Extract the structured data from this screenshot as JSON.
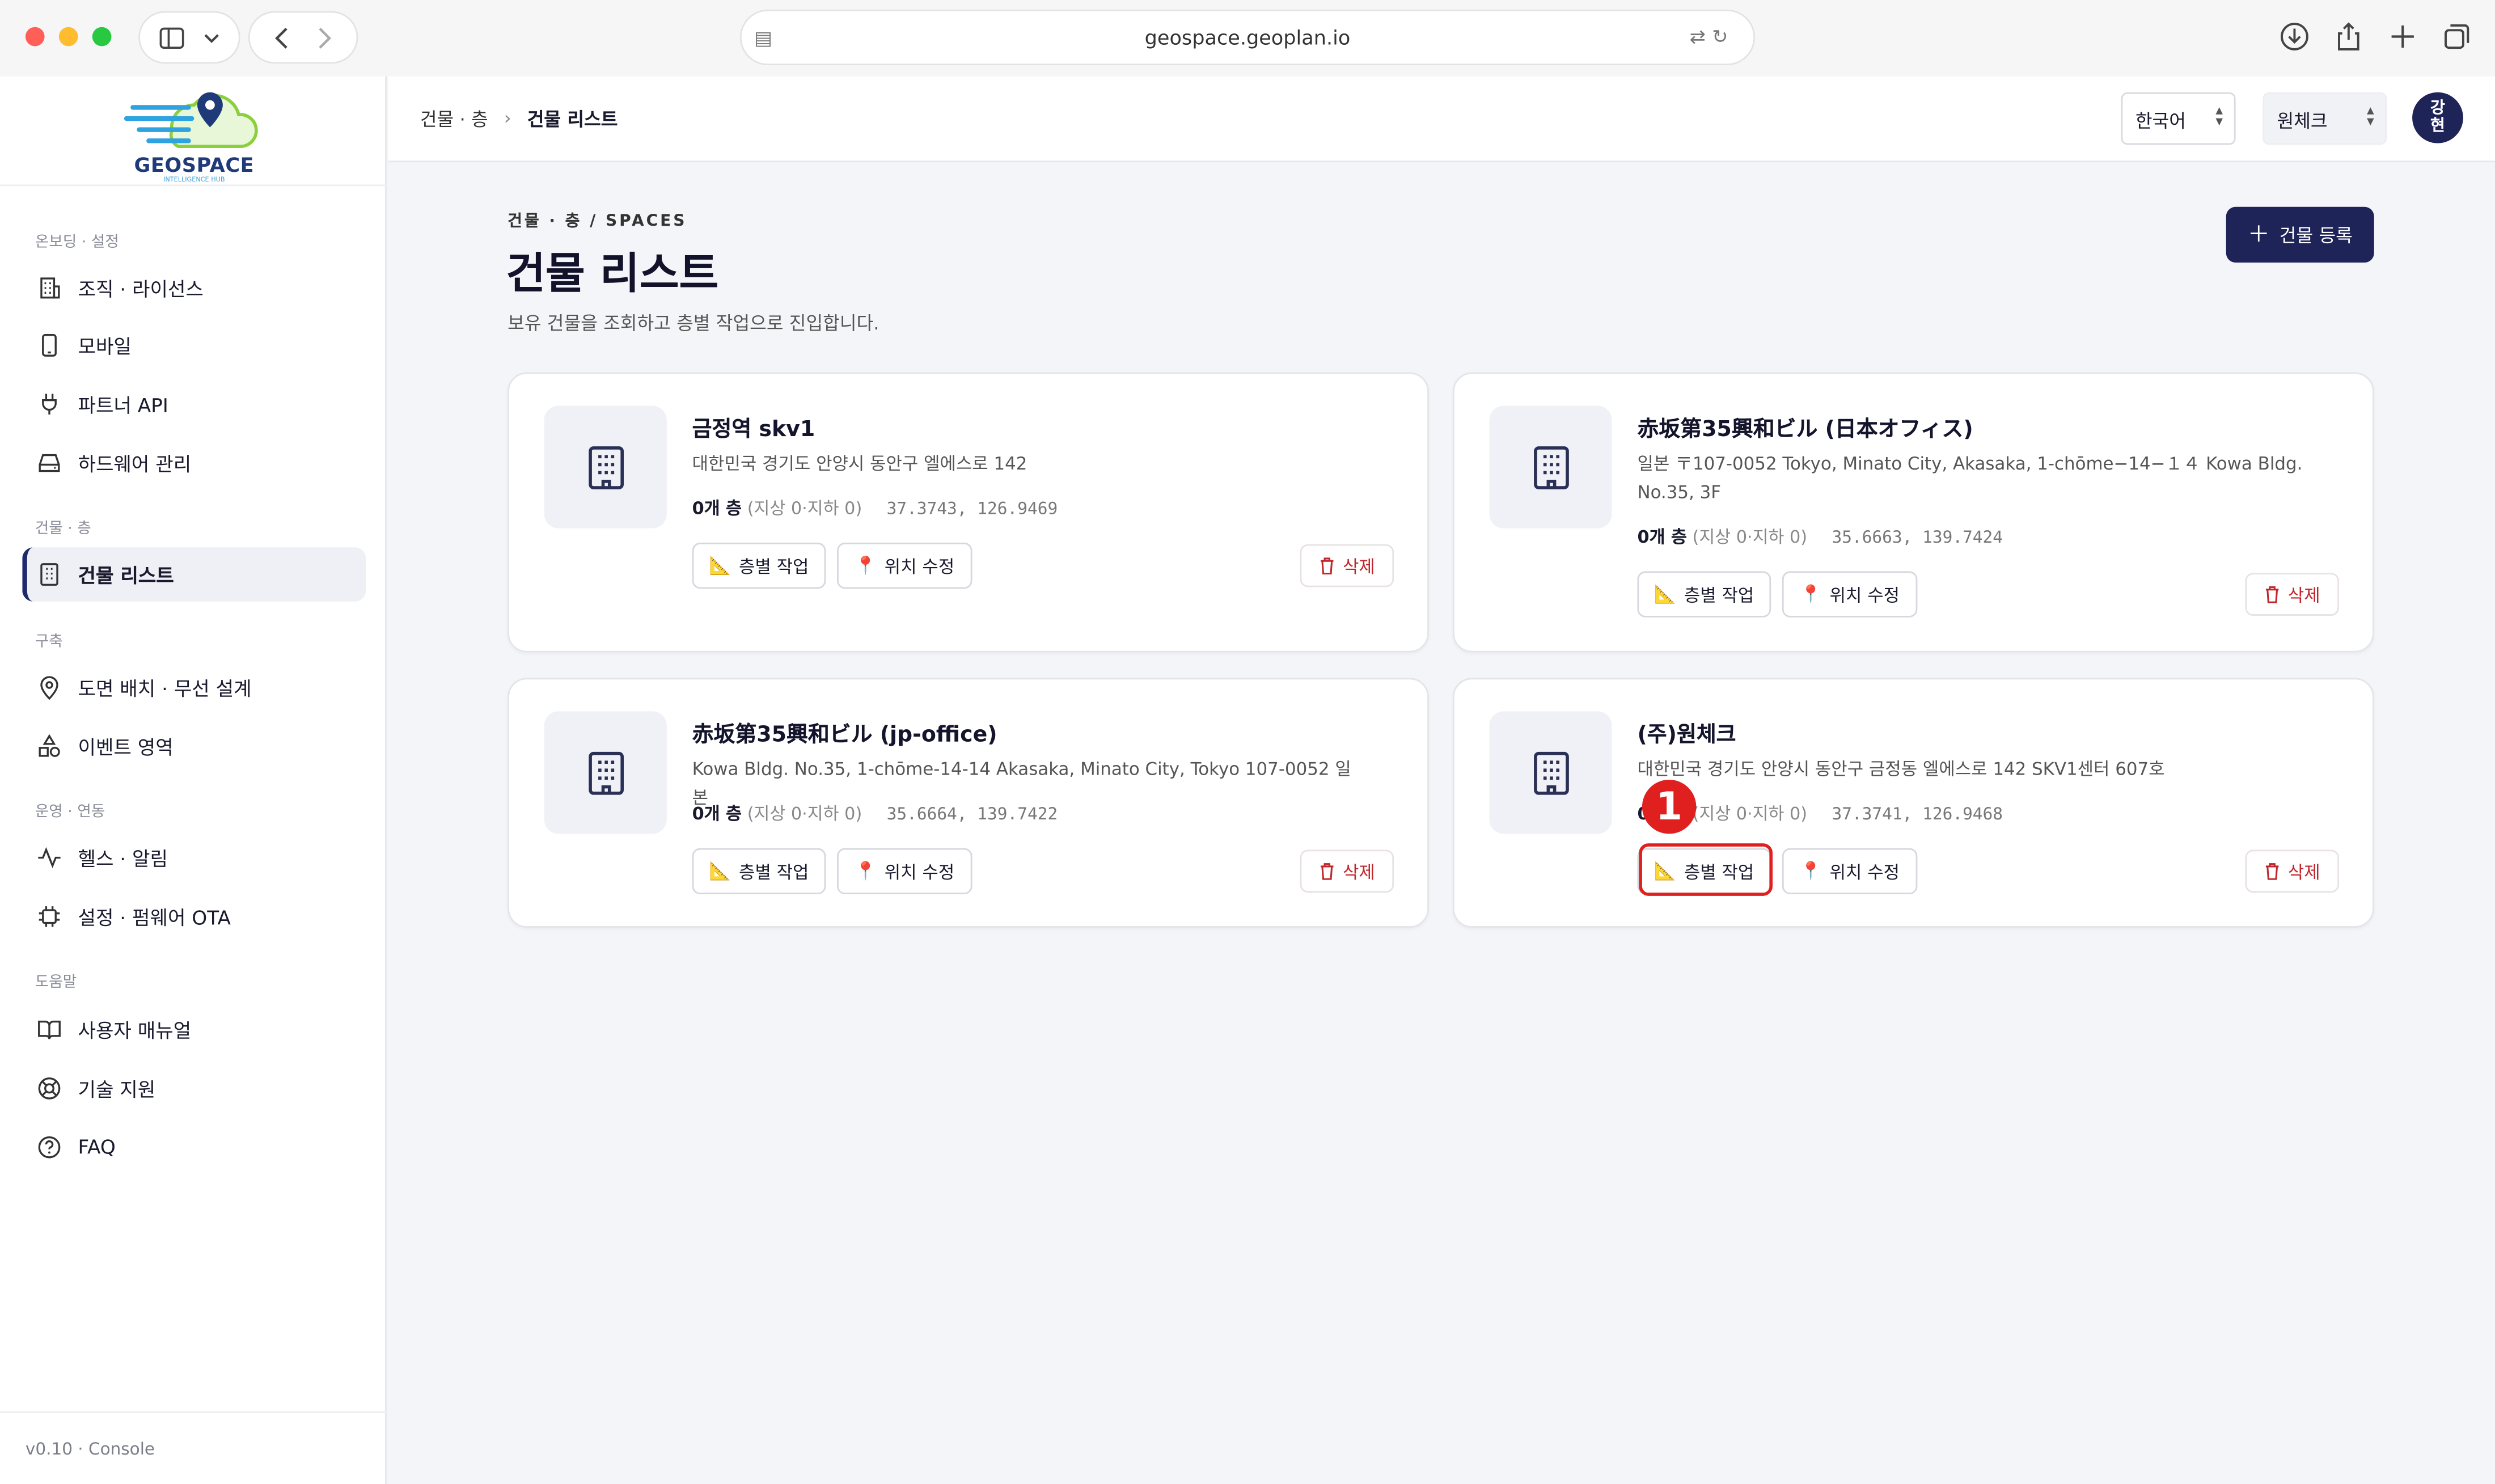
{
  "browser": {
    "url": "geospace.geoplan.io"
  },
  "logo": {
    "title": "GEOSPACE",
    "subtitle": "INTELLIGENCE HUB"
  },
  "sidebar": {
    "sections": [
      {
        "label": "온보딩 · 설정",
        "items": [
          {
            "label": "조직 · 라이선스",
            "icon": "building-icon"
          },
          {
            "label": "모바일",
            "icon": "mobile-icon"
          },
          {
            "label": "파트너 API",
            "icon": "plug-icon"
          },
          {
            "label": "하드웨어 관리",
            "icon": "hardware-icon"
          }
        ]
      },
      {
        "label": "건물 · 층",
        "items": [
          {
            "label": "건물 리스트",
            "icon": "building-list-icon",
            "active": true
          }
        ]
      },
      {
        "label": "구축",
        "items": [
          {
            "label": "도면 배치 · 무선 설계",
            "icon": "location-pin-icon"
          },
          {
            "label": "이벤트 영역",
            "icon": "shapes-icon"
          }
        ]
      },
      {
        "label": "운영 · 연동",
        "items": [
          {
            "label": "헬스 · 알림",
            "icon": "pulse-icon"
          },
          {
            "label": "설정 · 펌웨어 OTA",
            "icon": "chip-icon"
          }
        ]
      },
      {
        "label": "도움말",
        "items": [
          {
            "label": "사용자 매뉴얼",
            "icon": "book-icon"
          },
          {
            "label": "기술 지원",
            "icon": "lifebuoy-icon"
          },
          {
            "label": "FAQ",
            "icon": "question-icon"
          }
        ]
      }
    ],
    "version": "v0.10 · Console"
  },
  "topbar": {
    "breadcrumb": [
      "건물 · 층",
      "건물 리스트"
    ],
    "language": "한국어",
    "org": "원체크",
    "avatar": "강\n현"
  },
  "main": {
    "eyebrow": "건물 · 층 / SPACES",
    "title": "건물 리스트",
    "subtitle": "보유 건물을 조회하고 층별 작업으로 진입합니다.",
    "register_button": "건물 등록"
  },
  "labels": {
    "floor_work": "층별 작업",
    "edit_location": "위치 수정",
    "delete": "삭제"
  },
  "buildings": [
    {
      "name": "금정역 skv1",
      "address": "대한민국 경기도 안양시 동안구 엘에스로 142",
      "floors": "0개 층",
      "floors_detail": "(지상 0·지하 0)",
      "coords": "37.3743, 126.9469"
    },
    {
      "name": "赤坂第35興和ビル (日本オフィス)",
      "address": "일본 〒107-0052 Tokyo, Minato City, Akasaka, 1-chōme−14−１４ Kowa Bldg. No.35, 3F",
      "floors": "0개 층",
      "floors_detail": "(지상 0·지하 0)",
      "coords": "35.6663, 139.7424"
    },
    {
      "name": "赤坂第35興和ビル (jp-office)",
      "address": "Kowa Bldg. No.35, 1-chōme-14-14 Akasaka, Minato City, Tokyo 107-0052 일본",
      "floors": "0개 층",
      "floors_detail": "(지상 0·지하 0)",
      "coords": "35.6664, 139.7422"
    },
    {
      "name": "(주)원체크",
      "address": "대한민국 경기도 안양시 동안구 금정동 엘에스로 142 SKV1센터 607호",
      "floors": "0개 층",
      "floors_detail": "(지상 0·지하 0)",
      "coords": "37.3741, 126.9468"
    }
  ],
  "annotation": {
    "step": "1"
  }
}
